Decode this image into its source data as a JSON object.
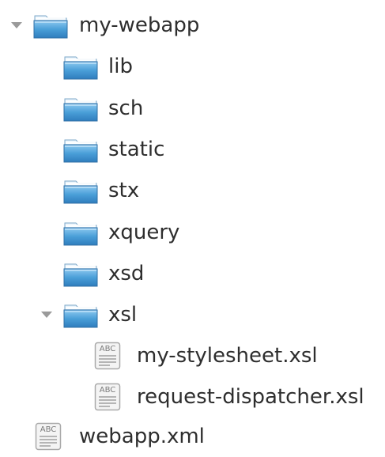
{
  "tree": {
    "root": {
      "label": "my-webapp",
      "expanded": true,
      "icon": "folder-icon"
    },
    "children": [
      {
        "label": "lib",
        "icon": "folder-icon"
      },
      {
        "label": "sch",
        "icon": "folder-icon"
      },
      {
        "label": "static",
        "icon": "folder-icon"
      },
      {
        "label": "stx",
        "icon": "folder-icon"
      },
      {
        "label": "xquery",
        "icon": "folder-icon"
      },
      {
        "label": "xsd",
        "icon": "folder-icon"
      },
      {
        "label": "xsl",
        "icon": "folder-icon",
        "expanded": true,
        "children": [
          {
            "label": "my-stylesheet.xsl",
            "icon": "text-file-icon"
          },
          {
            "label": "request-dispatcher.xsl",
            "icon": "text-file-icon"
          }
        ]
      }
    ],
    "root_file": {
      "label": "webapp.xml",
      "icon": "text-file-icon"
    },
    "file_icon_text": "ABC",
    "colors": {
      "folder_top": "#cfe8fb",
      "folder_body": "#4a9fd8",
      "folder_dark": "#2f7dbd",
      "expander": "#9a9a9a",
      "text": "#2e2e2e"
    }
  }
}
